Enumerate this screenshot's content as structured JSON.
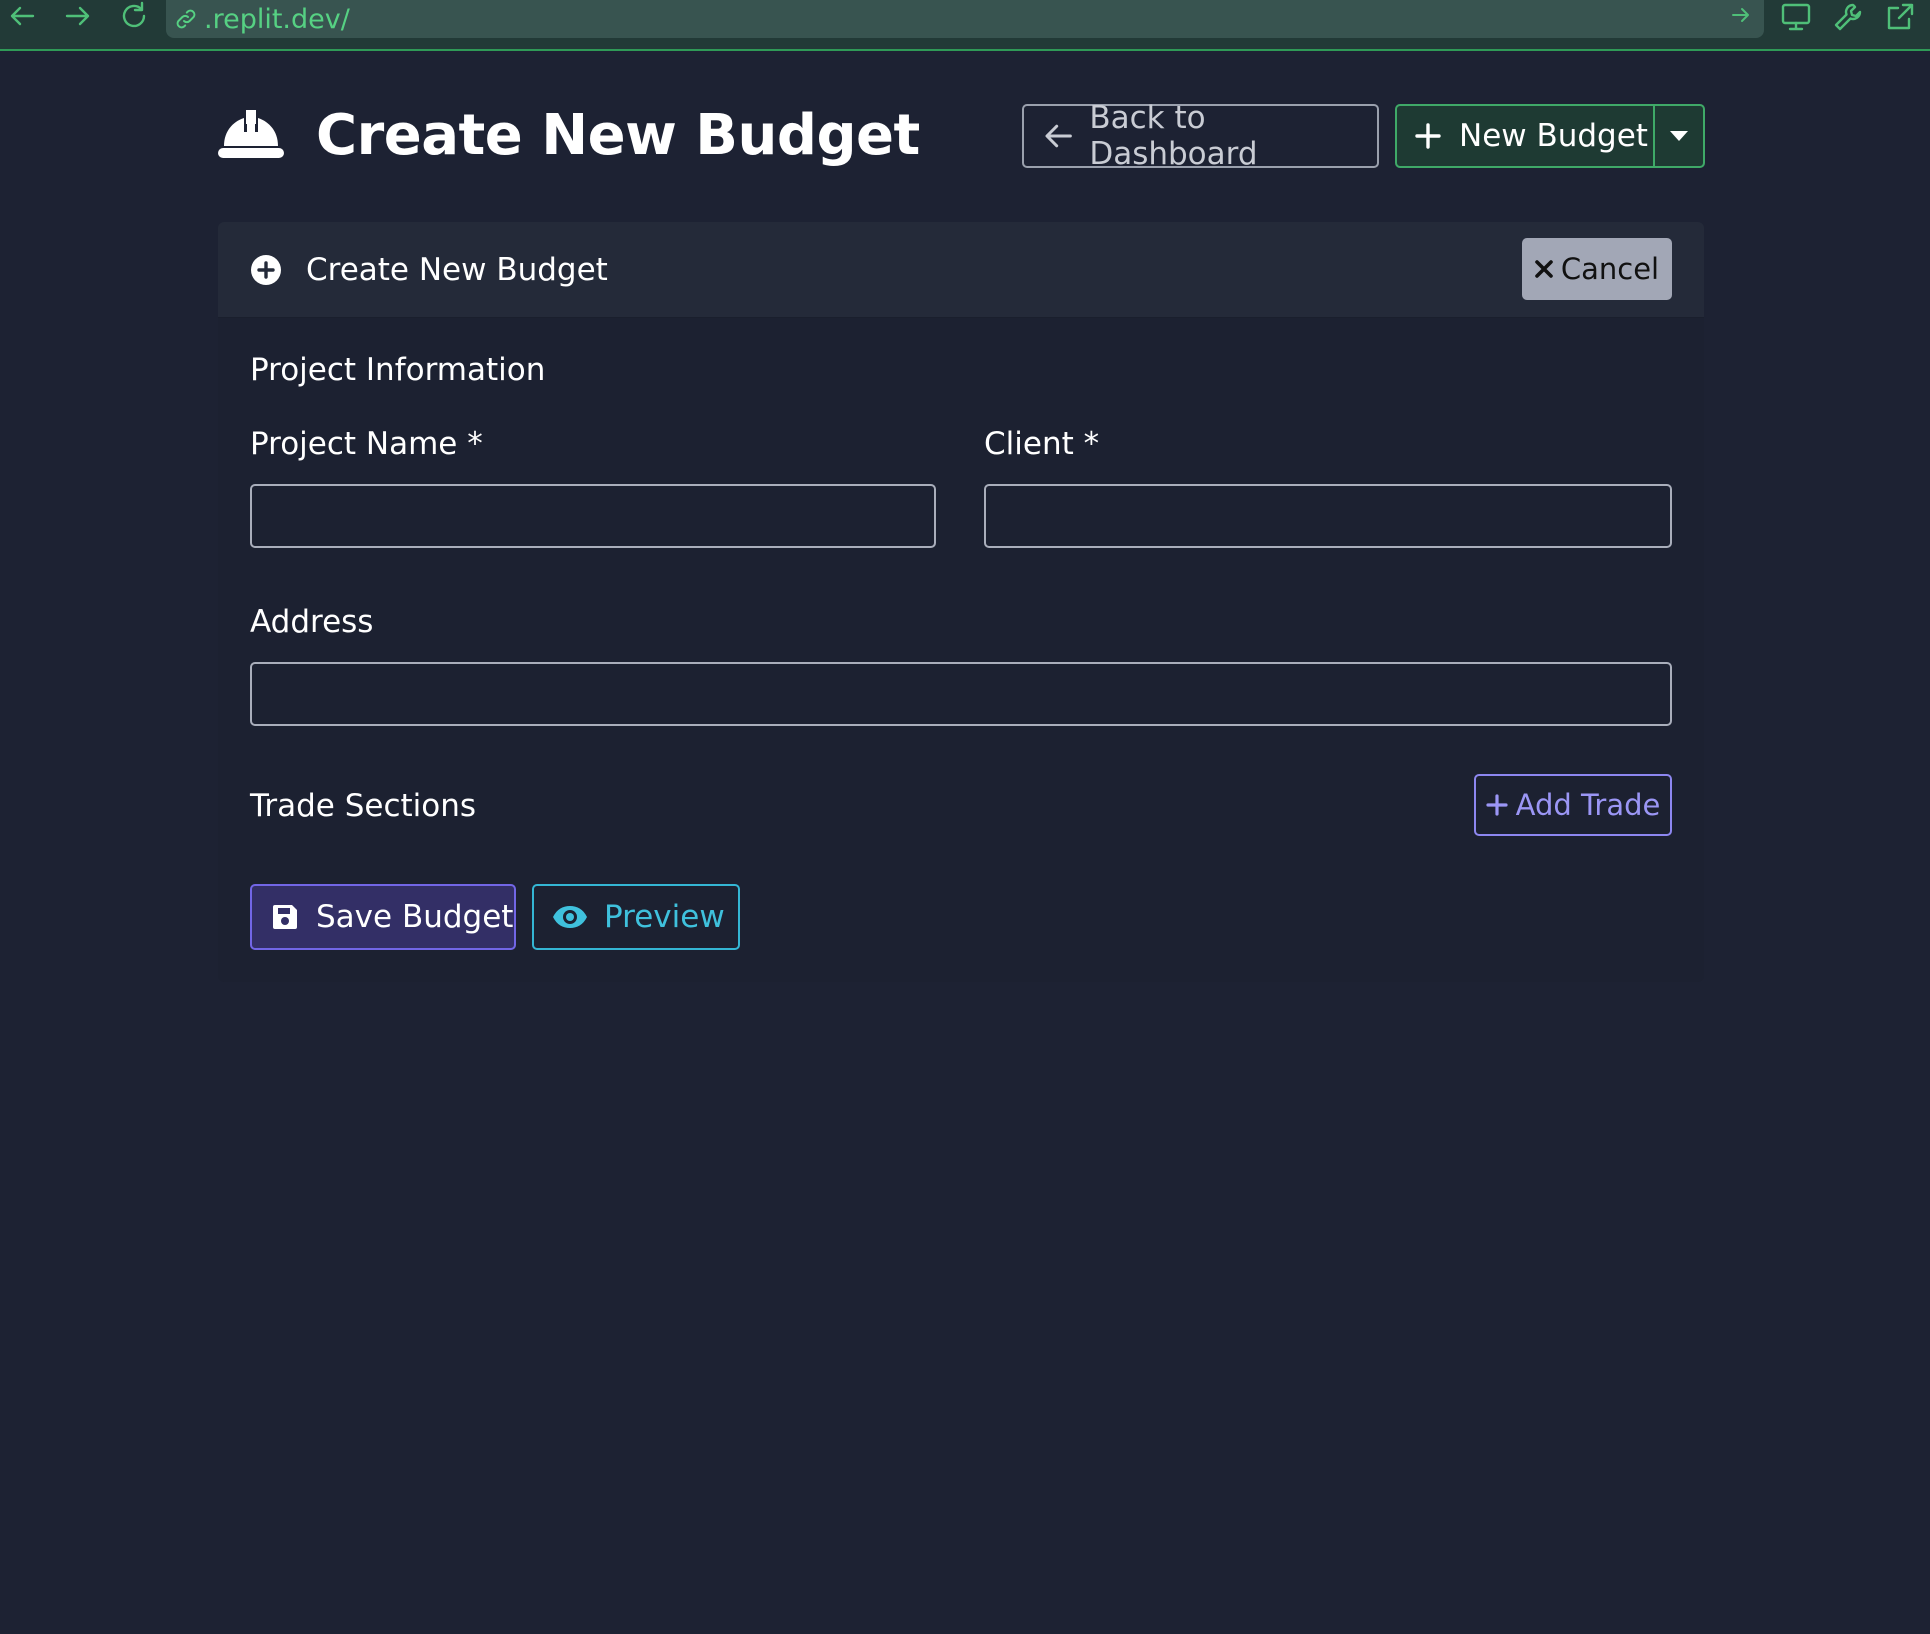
{
  "browser": {
    "url": ".replit.dev/",
    "icons": [
      "back-arrow-icon",
      "forward-arrow-icon",
      "reload-icon",
      "link-icon",
      "go-arrow-icon",
      "monitor-icon",
      "wrench-icon",
      "external-link-icon"
    ]
  },
  "header": {
    "title": "Create New Budget",
    "logo_icon": "hard-hat-icon",
    "back_label": "Back to Dashboard",
    "new_budget_label": "New Budget"
  },
  "card": {
    "title": "Create New Budget",
    "cancel_label": "Cancel",
    "section_project": "Project Information",
    "project_name_label": "Project Name *",
    "project_name_value": "",
    "client_label": "Client *",
    "client_value": "",
    "address_label": "Address",
    "address_value": "",
    "section_trades": "Trade Sections",
    "add_trade_label": "Add Trade",
    "save_label": "Save Budget",
    "preview_label": "Preview"
  },
  "colors": {
    "page_bg": "#1d2233",
    "card_header_bg": "#242a39",
    "success_accent": "#3fa968",
    "primary_accent": "#7266e6",
    "info_accent": "#34b6d4",
    "browser_accent": "#4fbf78"
  }
}
